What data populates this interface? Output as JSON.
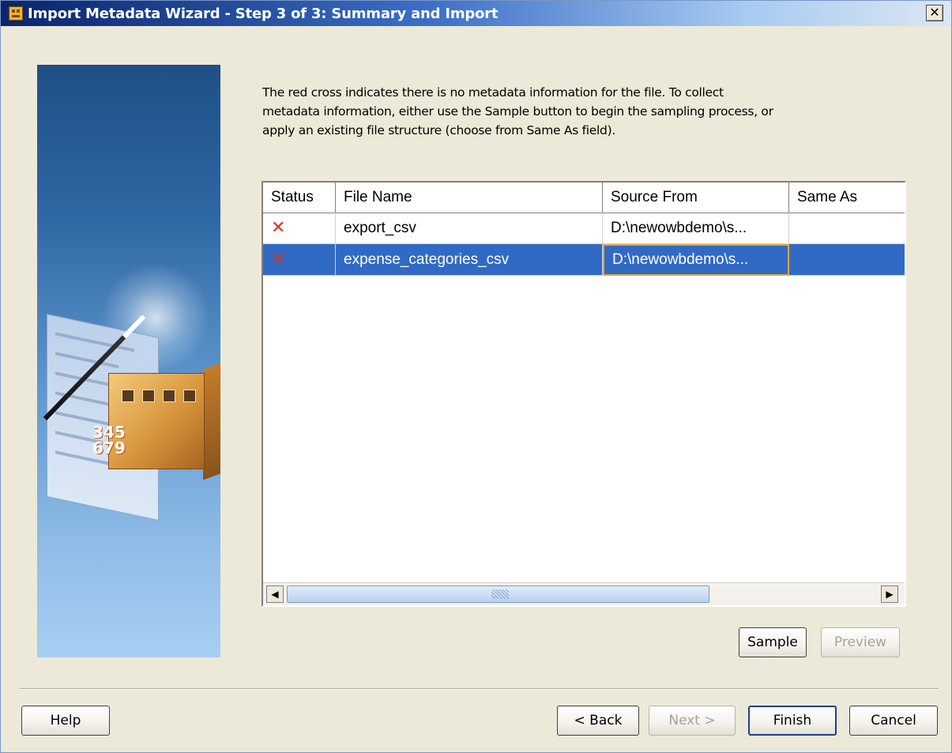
{
  "window": {
    "title": "Import Metadata Wizard - Step 3 of 3: Summary and Import",
    "close_glyph": "✕"
  },
  "illustration": {
    "numbers_line1": "345",
    "numbers_line2": "679"
  },
  "instructions": {
    "line1": "The red cross indicates there is no metadata information for the file. To collect",
    "line2": "metadata information, either use the Sample button to begin the sampling process, or",
    "line3": "apply an existing file structure (choose from Same As field)."
  },
  "table": {
    "columns": [
      "Status",
      "File Name",
      "Source From",
      "Same As"
    ],
    "rows": [
      {
        "status_icon": "red-cross-icon",
        "status_glyph": "✕",
        "file_name": "export_csv",
        "source_from": "D:\\newowbdemo\\s...",
        "same_as": "",
        "selected": false
      },
      {
        "status_icon": "red-cross-icon",
        "status_glyph": "✕",
        "file_name": "expense_categories_csv",
        "source_from": "D:\\newowbdemo\\s...",
        "same_as": "",
        "selected": true
      }
    ],
    "scroll_left_glyph": "◀",
    "scroll_right_glyph": "▶"
  },
  "buttons": {
    "sample": "Sample",
    "preview": "Preview",
    "help": "Help",
    "back": "< Back",
    "next": "Next >",
    "finish": "Finish",
    "cancel": "Cancel"
  },
  "colors": {
    "selection": "#316ac5",
    "status_cross": "#e0311a",
    "focus_border": "#e8a33d"
  }
}
